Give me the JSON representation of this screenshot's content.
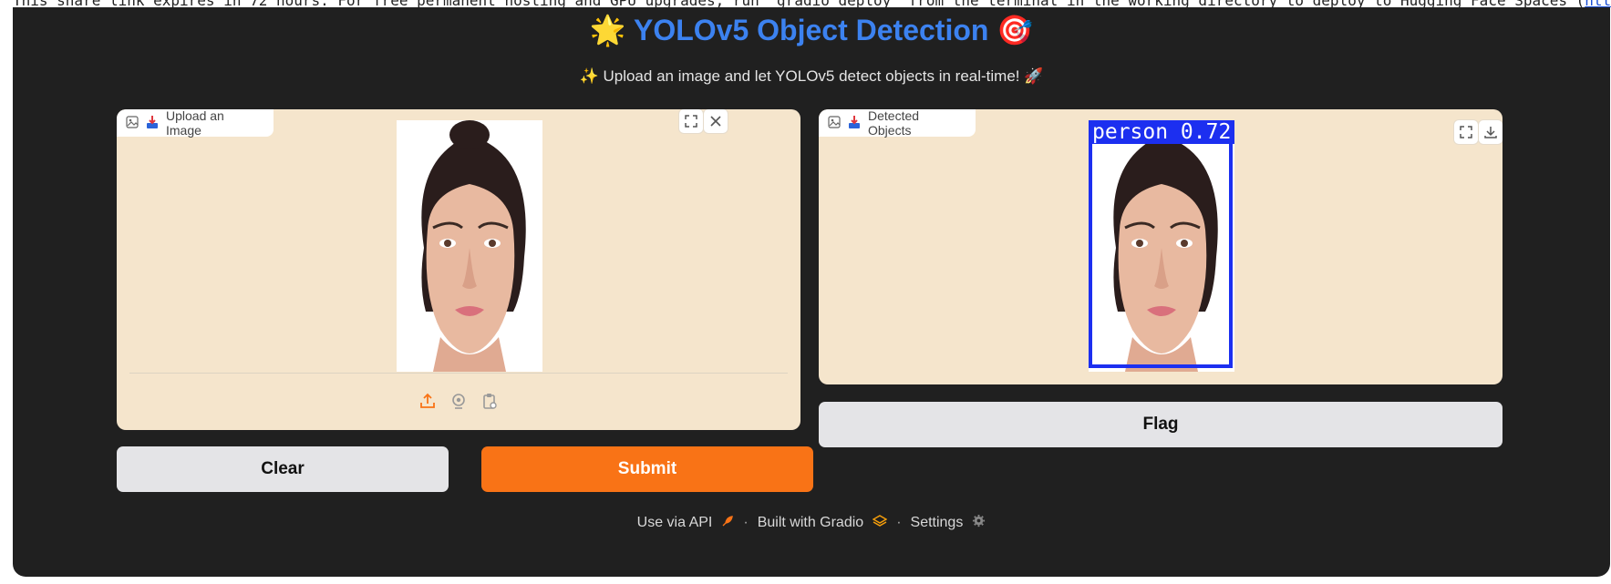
{
  "notice": {
    "text": "This share link expires in 72 hours. For free permanent hosting and GPU upgrades, run `gradio deploy` from the terminal in the working directory to deploy to Hugging Face Spaces (",
    "link": "htt"
  },
  "header": {
    "title": "YOLOv5 Object Detection",
    "title_emoji_left": "🌟",
    "title_emoji_right": "🎯",
    "subtitle": "Upload an image and let YOLOv5 detect objects in real-time!",
    "subtitle_emoji_left": "✨",
    "subtitle_emoji_right": "🚀"
  },
  "input_panel": {
    "label": "Upload an Image",
    "icons": [
      "image-icon",
      "upload-label-icon",
      "fullscreen-icon",
      "close-icon",
      "upload-icon",
      "webcam-icon",
      "clipboard-icon"
    ]
  },
  "output_panel": {
    "label": "Detected Objects",
    "detection": {
      "label": "person 0.72"
    },
    "icons": [
      "image-icon",
      "download-label-icon",
      "fullscreen-icon",
      "download-icon"
    ]
  },
  "buttons": {
    "clear": "Clear",
    "submit": "Submit",
    "flag": "Flag"
  },
  "footer": {
    "api": "Use via API",
    "built": "Built with Gradio",
    "settings": "Settings",
    "separator": "·"
  },
  "colors": {
    "accent": "#f97316",
    "title": "#3c82f0",
    "panel_bg": "#f5e5cc",
    "bbox": "#1c2ff0"
  }
}
